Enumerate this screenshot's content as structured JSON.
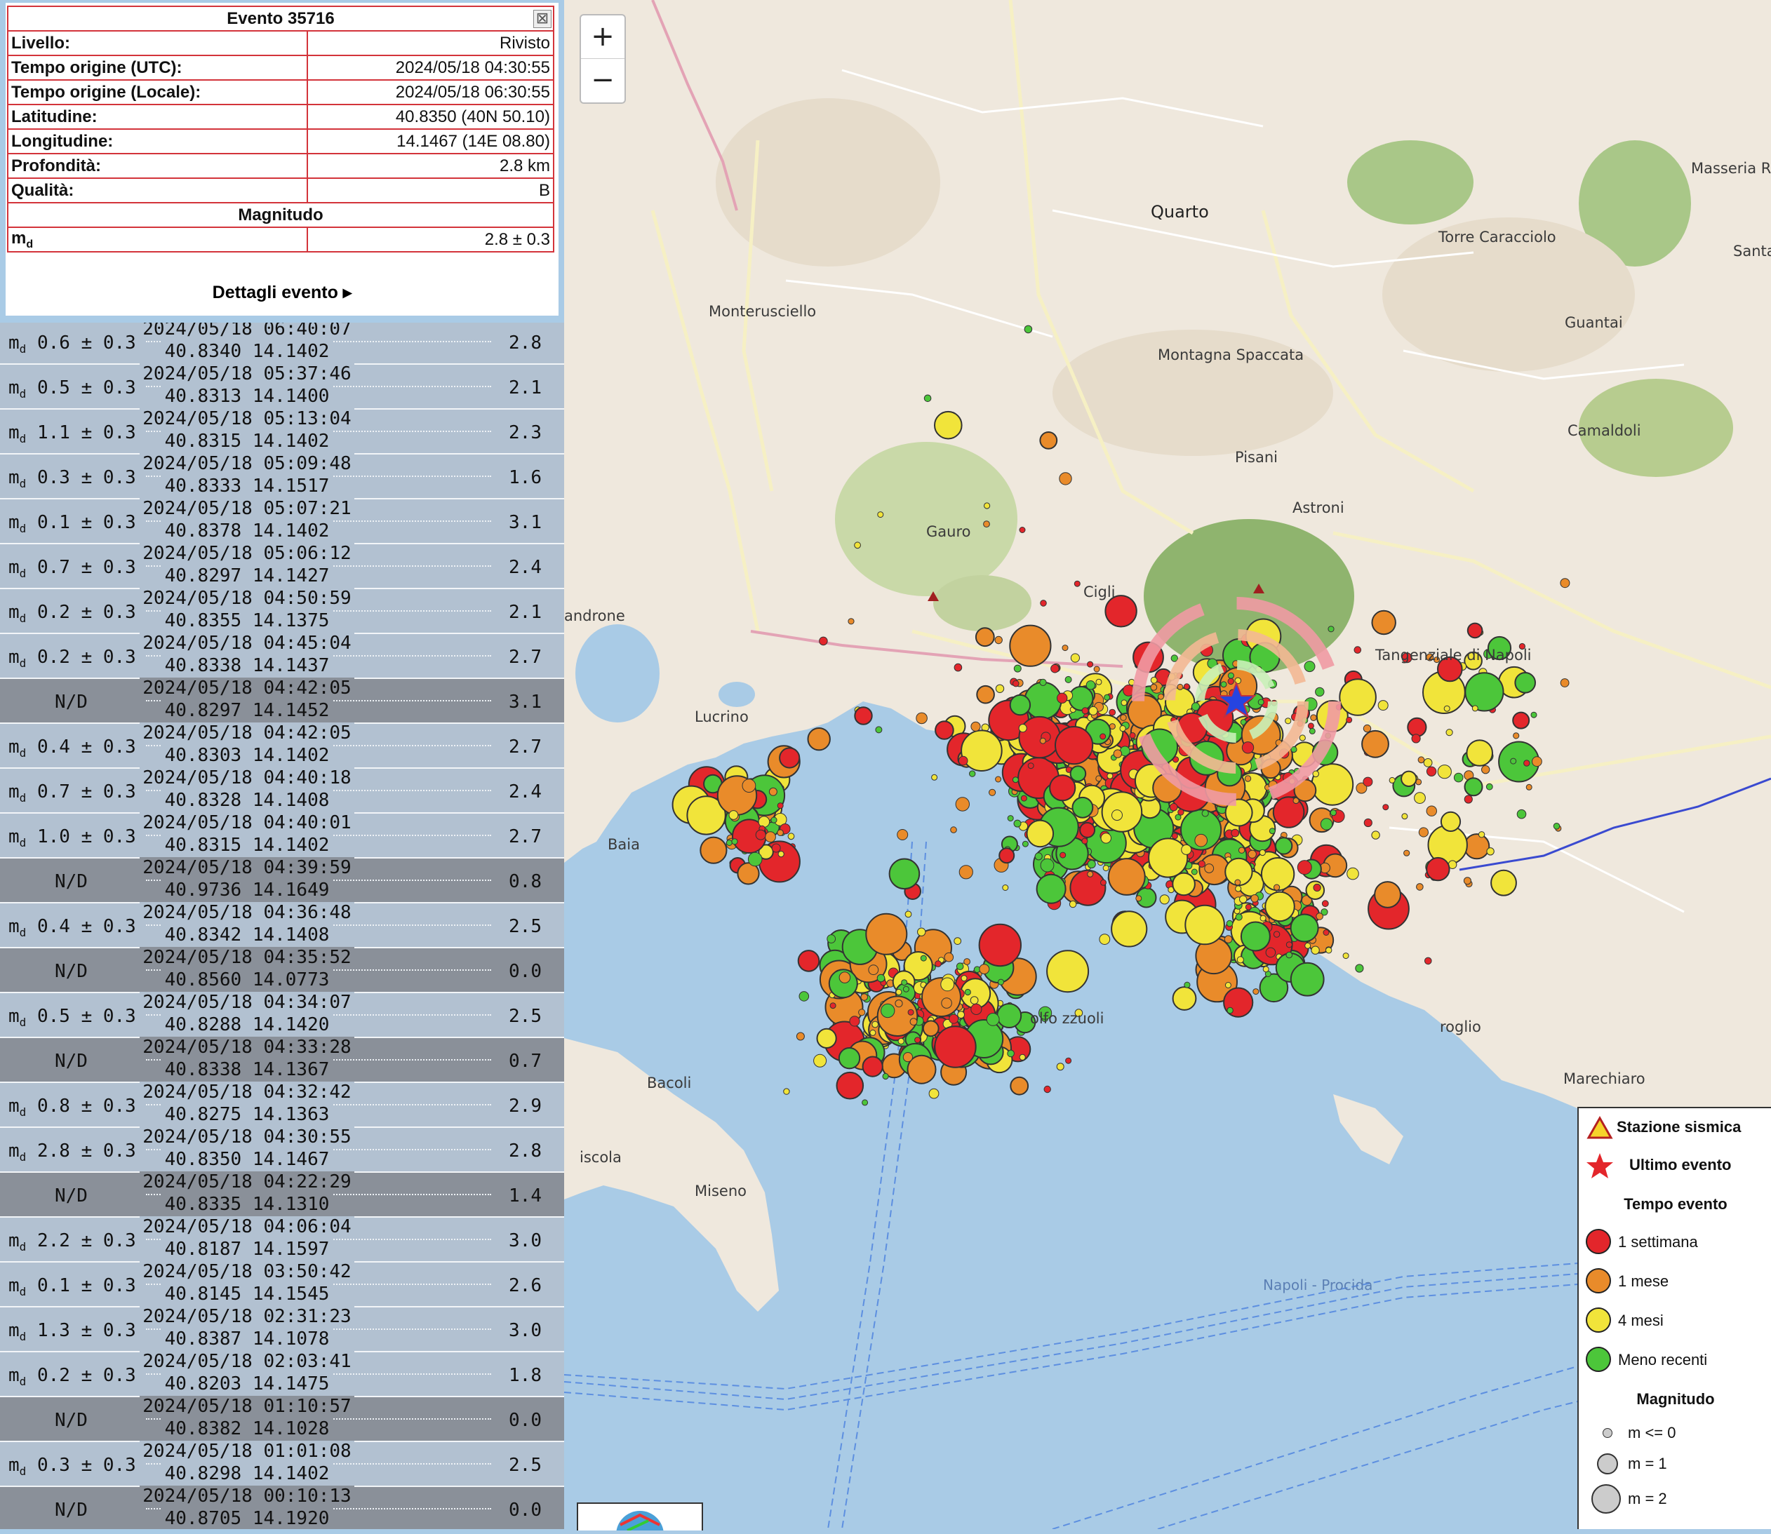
{
  "popup": {
    "title": "Evento 35716",
    "rows": [
      {
        "k": "Livello:",
        "v": "Rivisto"
      },
      {
        "k": "Tempo origine (UTC):",
        "v": "2024/05/18 04:30:55"
      },
      {
        "k": "Tempo origine (Locale):",
        "v": "2024/05/18 06:30:55"
      },
      {
        "k": "Latitudine:",
        "v": "40.8350 (40N 50.10)"
      },
      {
        "k": "Longitudine:",
        "v": "14.1467 (14E 08.80)"
      },
      {
        "k": "Profondità:",
        "v": "2.8 km"
      },
      {
        "k": "Qualità:",
        "v": "B"
      }
    ],
    "magnitude_header": "Magnitudo",
    "md_label": "m",
    "md_sub": "d",
    "md_value": "2.8 ± 0.3",
    "details_label": "Dettagli evento ▸"
  },
  "zoom": {
    "in": "+",
    "out": "−"
  },
  "events": [
    {
      "mag": "0.6 ± 0.3",
      "time": "2024/05/18 06:40:07",
      "coords": "40.8340 14.1402",
      "value": "2.8",
      "nd": false
    },
    {
      "mag": "0.5 ± 0.3",
      "time": "2024/05/18 05:37:46",
      "coords": "40.8313 14.1400",
      "value": "2.1",
      "nd": false
    },
    {
      "mag": "1.1 ± 0.3",
      "time": "2024/05/18 05:13:04",
      "coords": "40.8315 14.1402",
      "value": "2.3",
      "nd": false
    },
    {
      "mag": "0.3 ± 0.3",
      "time": "2024/05/18 05:09:48",
      "coords": "40.8333 14.1517",
      "value": "1.6",
      "nd": false
    },
    {
      "mag": "0.1 ± 0.3",
      "time": "2024/05/18 05:07:21",
      "coords": "40.8378 14.1402",
      "value": "3.1",
      "nd": false
    },
    {
      "mag": "0.7 ± 0.3",
      "time": "2024/05/18 05:06:12",
      "coords": "40.8297 14.1427",
      "value": "2.4",
      "nd": false
    },
    {
      "mag": "0.2 ± 0.3",
      "time": "2024/05/18 04:50:59",
      "coords": "40.8355 14.1375",
      "value": "2.1",
      "nd": false
    },
    {
      "mag": "0.2 ± 0.3",
      "time": "2024/05/18 04:45:04",
      "coords": "40.8338 14.1437",
      "value": "2.7",
      "nd": false
    },
    {
      "mag": "N/D",
      "time": "2024/05/18 04:42:05",
      "coords": "40.8297 14.1452",
      "value": "3.1",
      "nd": true
    },
    {
      "mag": "0.4 ± 0.3",
      "time": "2024/05/18 04:42:05",
      "coords": "40.8303 14.1402",
      "value": "2.7",
      "nd": false
    },
    {
      "mag": "0.7 ± 0.3",
      "time": "2024/05/18 04:40:18",
      "coords": "40.8328 14.1408",
      "value": "2.4",
      "nd": false
    },
    {
      "mag": "1.0 ± 0.3",
      "time": "2024/05/18 04:40:01",
      "coords": "40.8315 14.1402",
      "value": "2.7",
      "nd": false
    },
    {
      "mag": "N/D",
      "time": "2024/05/18 04:39:59",
      "coords": "40.9736 14.1649",
      "value": "0.8",
      "nd": true
    },
    {
      "mag": "0.4 ± 0.3",
      "time": "2024/05/18 04:36:48",
      "coords": "40.8342 14.1408",
      "value": "2.5",
      "nd": false
    },
    {
      "mag": "N/D",
      "time": "2024/05/18 04:35:52",
      "coords": "40.8560 14.0773",
      "value": "0.0",
      "nd": true
    },
    {
      "mag": "0.5 ± 0.3",
      "time": "2024/05/18 04:34:07",
      "coords": "40.8288 14.1420",
      "value": "2.5",
      "nd": false
    },
    {
      "mag": "N/D",
      "time": "2024/05/18 04:33:28",
      "coords": "40.8338 14.1367",
      "value": "0.7",
      "nd": true
    },
    {
      "mag": "0.8 ± 0.3",
      "time": "2024/05/18 04:32:42",
      "coords": "40.8275 14.1363",
      "value": "2.9",
      "nd": false
    },
    {
      "mag": "2.8 ± 0.3",
      "time": "2024/05/18 04:30:55",
      "coords": "40.8350 14.1467",
      "value": "2.8",
      "nd": false
    },
    {
      "mag": "N/D",
      "time": "2024/05/18 04:22:29",
      "coords": "40.8335 14.1310",
      "value": "1.4",
      "nd": true
    },
    {
      "mag": "2.2 ± 0.3",
      "time": "2024/05/18 04:06:04",
      "coords": "40.8187 14.1597",
      "value": "3.0",
      "nd": false
    },
    {
      "mag": "0.1 ± 0.3",
      "time": "2024/05/18 03:50:42",
      "coords": "40.8145 14.1545",
      "value": "2.6",
      "nd": false
    },
    {
      "mag": "1.3 ± 0.3",
      "time": "2024/05/18 02:31:23",
      "coords": "40.8387 14.1078",
      "value": "3.0",
      "nd": false
    },
    {
      "mag": "0.2 ± 0.3",
      "time": "2024/05/18 02:03:41",
      "coords": "40.8203 14.1475",
      "value": "1.8",
      "nd": false
    },
    {
      "mag": "N/D",
      "time": "2024/05/18 01:10:57",
      "coords": "40.8382 14.1028",
      "value": "0.0",
      "nd": true
    },
    {
      "mag": "0.3 ± 0.3",
      "time": "2024/05/18 01:01:08",
      "coords": "40.8298 14.1402",
      "value": "2.5",
      "nd": false
    },
    {
      "mag": "N/D",
      "time": "2024/05/18 00:10:13",
      "coords": "40.8705 14.1920",
      "value": "0.0",
      "nd": true
    }
  ],
  "places": [
    {
      "name": "Quarto"
    },
    {
      "name": "Torre Caracciolo"
    },
    {
      "name": "Masseria R"
    },
    {
      "name": "Santa C"
    },
    {
      "name": "Monterusciello"
    },
    {
      "name": "Guantai"
    },
    {
      "name": "Montagna Spaccata"
    },
    {
      "name": "Camaldoli"
    },
    {
      "name": "Pisani"
    },
    {
      "name": "Astroni"
    },
    {
      "name": "Gauro"
    },
    {
      "name": "androne"
    },
    {
      "name": "Lucrino"
    },
    {
      "name": "Baia"
    },
    {
      "name": "Bacoli"
    },
    {
      "name": "iscola"
    },
    {
      "name": "Miseno"
    },
    {
      "name": "Marechiaro"
    },
    {
      "name": "roglio"
    },
    {
      "name": "Napoli - Procida"
    },
    {
      "name": "Tangenziale di Napoli"
    },
    {
      "name": "Cigli"
    },
    {
      "name": "olfo zzuoli"
    }
  ],
  "legend": {
    "station": "Stazione sismica",
    "last_event": "Ultimo evento",
    "time_title": "Tempo evento",
    "week": "1 settimana",
    "month": "1 mese",
    "months4": "4 mesi",
    "older": "Meno recenti",
    "mag_title": "Magnitudo",
    "m0": "m <= 0",
    "m1": "m = 1",
    "m2": "m = 2",
    "colors": {
      "week": "#e3262b",
      "month": "#e98b2a",
      "months4": "#f1e43a",
      "older": "#4cc63a",
      "station": "#f6d32b",
      "last": "#e3262b",
      "star": "#2644e0"
    }
  }
}
